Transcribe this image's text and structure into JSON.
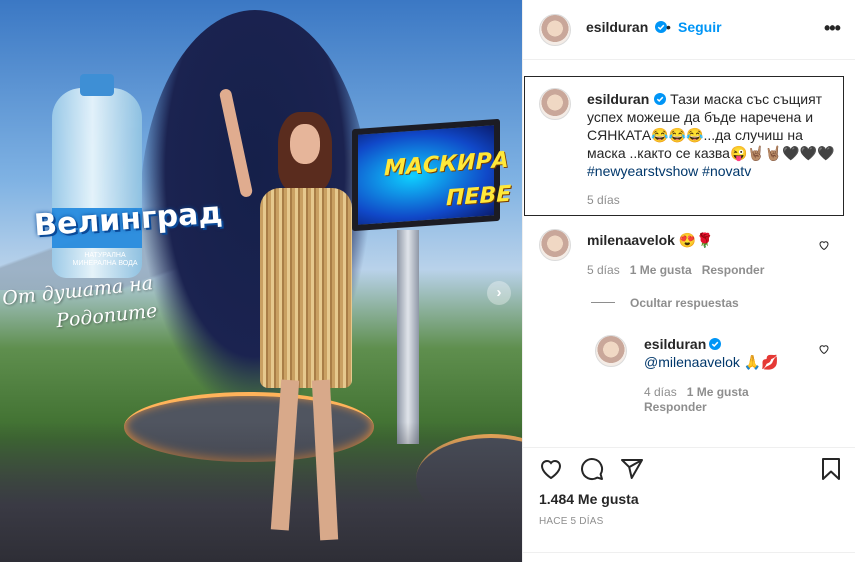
{
  "photo": {
    "brand": "Велинград",
    "brand_sub": "НАТУРАЛНА МИНЕРАЛНА ВОДА",
    "slogan_line1": "От душата на",
    "slogan_line2": "Родопите",
    "screen_line1": "МАСКИРА",
    "screen_line2": "ПЕВЕ",
    "next_icon": "chevron-right-icon"
  },
  "header": {
    "username": "esilduran",
    "dot": "•",
    "follow": "Seguir",
    "more": "•••"
  },
  "caption": {
    "username": "esilduran",
    "text": "Тази маска със същият успех можеше да бъде наречена и СЯНКАТА😂😂😂...да случиш на маска ..както се казва😜🤘🏽🤘🏽🖤🖤🖤",
    "hashtags": "#newyearstvshow #novatv",
    "time": "5 días"
  },
  "comments": [
    {
      "username": "milenaavelok",
      "text": "😍🌹",
      "time": "5 días",
      "likes": "1 Me gusta",
      "reply": "Responder"
    }
  ],
  "hide_replies": "Ocultar respuestas",
  "reply": {
    "username": "esilduran",
    "mention": "@milenaavelok",
    "text": "🙏💋",
    "time": "4 días",
    "likes": "1 Me gusta",
    "reply": "Responder"
  },
  "actions": {
    "likes": "1.484 Me gusta",
    "posted": "HACE 5 DÍAS"
  },
  "colors": {
    "accent": "#0095f6",
    "text": "#262626",
    "muted": "#8e8e8e",
    "verified": "#0095f6",
    "link": "#00376b"
  }
}
